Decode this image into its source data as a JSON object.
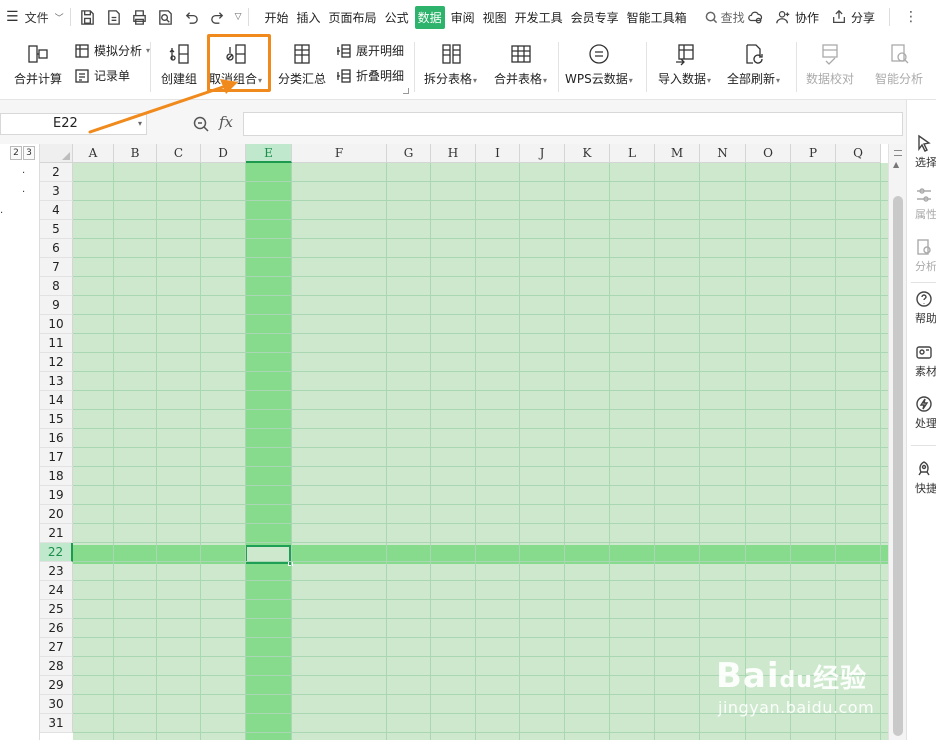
{
  "menubar": {
    "file_label": "文件",
    "tabs": [
      "开始",
      "插入",
      "页面布局",
      "公式",
      "数据",
      "审阅",
      "视图",
      "开发工具",
      "会员专享",
      "智能工具箱"
    ],
    "active_tab": "数据",
    "search_label": "查找",
    "collaborate_label": "协作",
    "share_label": "分享"
  },
  "ribbon": {
    "merge_calc": "合并计算",
    "simulate_analysis": "模拟分析",
    "record_form": "记录单",
    "create_group": "创建组",
    "ungroup": "取消组合",
    "subtotal": "分类汇总",
    "expand_detail": "展开明细",
    "collapse_detail": "折叠明细",
    "split_table": "拆分表格",
    "merge_table": "合并表格",
    "wps_cloud_data": "WPS云数据",
    "import_data": "导入数据",
    "refresh_all": "全部刷新",
    "data_check": "数据校对",
    "smart_analysis": "智能分析"
  },
  "formula_bar": {
    "name_box": "E22",
    "fx_label": "fx",
    "formula": ""
  },
  "sheet": {
    "outline_levels": [
      "2",
      "3"
    ],
    "columns": [
      "A",
      "B",
      "C",
      "D",
      "E",
      "F",
      "G",
      "H",
      "I",
      "J",
      "K",
      "L",
      "M",
      "N",
      "O",
      "P",
      "Q"
    ],
    "rows": [
      "2",
      "3",
      "4",
      "5",
      "6",
      "7",
      "8",
      "9",
      "10",
      "11",
      "12",
      "13",
      "14",
      "15",
      "16",
      "17",
      "18",
      "19",
      "20",
      "21",
      "22",
      "23",
      "24",
      "25",
      "26",
      "27",
      "28",
      "29",
      "30",
      "31"
    ],
    "selected_column": "E",
    "selected_row": "22",
    "active_cell": "E22"
  },
  "side_panel": {
    "items": [
      "选择",
      "属性",
      "分析",
      "帮助",
      "素材",
      "处理",
      "快捷"
    ]
  },
  "watermark": {
    "brand": "Bai",
    "brand_paw": "du",
    "brand_cn": "经验",
    "url": "jingyan.baidu.com"
  },
  "colors": {
    "accent": "#2db36b",
    "highlight_box": "#f08a1c",
    "cell_fill": "#cde8cd",
    "selection_band": "#86dc8c"
  }
}
